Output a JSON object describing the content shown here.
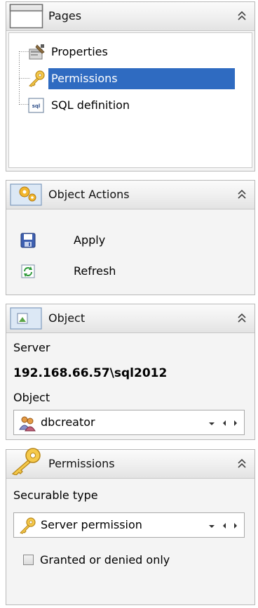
{
  "pages": {
    "title": "Pages",
    "items": [
      {
        "label": "Properties",
        "icon": "properties-icon"
      },
      {
        "label": "Permissions",
        "icon": "key-icon",
        "selected": true
      },
      {
        "label": "SQL definition",
        "icon": "sql-icon"
      }
    ]
  },
  "actions": {
    "title": "Object Actions",
    "items": [
      {
        "label": "Apply",
        "icon": "save-icon"
      },
      {
        "label": "Refresh",
        "icon": "refresh-icon"
      }
    ]
  },
  "object": {
    "title": "Object",
    "server_label": "Server",
    "server_value": "192.168.66.57\\sql2012",
    "object_label": "Object",
    "object_value": "dbcreator"
  },
  "permissions": {
    "title": "Permissions",
    "securable_label": "Securable type",
    "securable_value": "Server permission",
    "granted_label": "Granted or denied only",
    "granted_checked": false
  },
  "colors": {
    "selection": "#2f6bc1",
    "panel_bg": "#f4f4f4"
  }
}
